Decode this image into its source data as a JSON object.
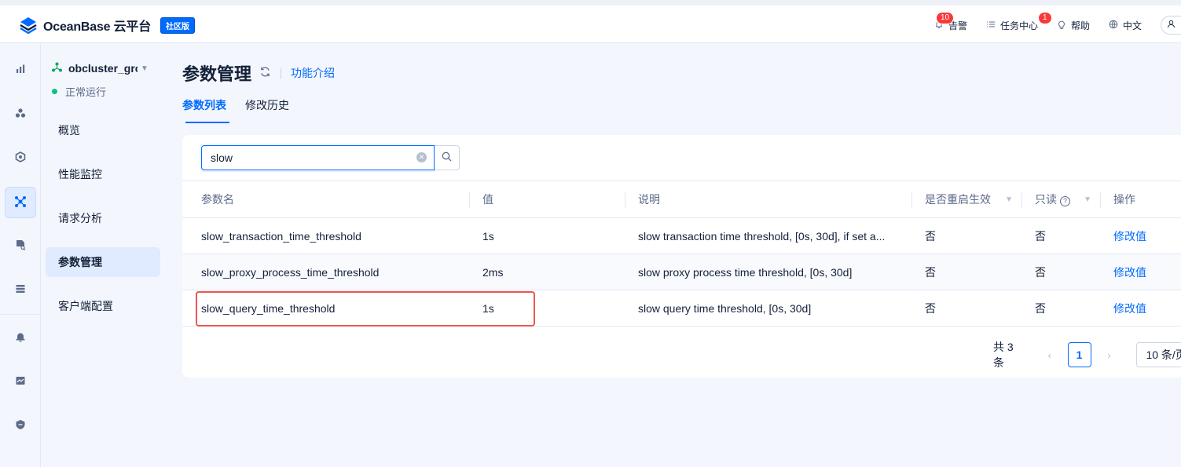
{
  "header": {
    "logo_text": "OceanBase 云平台",
    "edition_badge": "社区版",
    "actions": [
      {
        "icon": "bell-icon",
        "label": "告警",
        "badge": "10"
      },
      {
        "icon": "list-icon",
        "label": "任务中心",
        "badge": "1"
      },
      {
        "icon": "lightbulb-icon",
        "label": "帮助"
      },
      {
        "icon": "globe-icon",
        "label": "中文"
      }
    ],
    "user_icon": "user-icon"
  },
  "rail": {
    "icons": [
      "bar-chart-icon",
      "cluster-icon",
      "cube-icon",
      "topology-icon",
      "file-search-icon",
      "database-icon",
      "alarm-icon",
      "monitor-chart-icon",
      "shield-icon"
    ],
    "active_index": 3
  },
  "sidebar": {
    "cluster_name": "obcluster_grc",
    "cluster_status": "正常运行",
    "items": [
      {
        "label": "概览"
      },
      {
        "label": "性能监控"
      },
      {
        "label": "请求分析"
      },
      {
        "label": "参数管理"
      },
      {
        "label": "客户端配置"
      }
    ],
    "active_index": 3
  },
  "page": {
    "title": "参数管理",
    "intro_link": "功能介绍",
    "tabs": [
      {
        "label": "参数列表"
      },
      {
        "label": "修改历史"
      }
    ],
    "active_tab": 0
  },
  "search": {
    "value": "slow",
    "placeholder": ""
  },
  "table": {
    "columns": [
      "参数名",
      "值",
      "说明",
      "是否重启生效",
      "只读",
      "操作"
    ],
    "rows": [
      {
        "name": "slow_transaction_time_threshold",
        "value": "1s",
        "desc": "slow transaction time threshold, [0s, 30d], if set a...",
        "restart": "否",
        "readonly": "否",
        "action": "修改值"
      },
      {
        "name": "slow_proxy_process_time_threshold",
        "value": "2ms",
        "desc": "slow proxy process time threshold, [0s, 30d]",
        "restart": "否",
        "readonly": "否",
        "action": "修改值"
      },
      {
        "name": "slow_query_time_threshold",
        "value": "1s",
        "desc": "slow query time threshold, [0s, 30d]",
        "restart": "否",
        "readonly": "否",
        "action": "修改值"
      }
    ]
  },
  "pagination": {
    "total_text": "共 3 条",
    "current_page": "1",
    "page_size": "10 条/页"
  },
  "colors": {
    "accent": "#006aff",
    "status_ok": "#0ac185",
    "highlight_box": "#e8584f"
  }
}
